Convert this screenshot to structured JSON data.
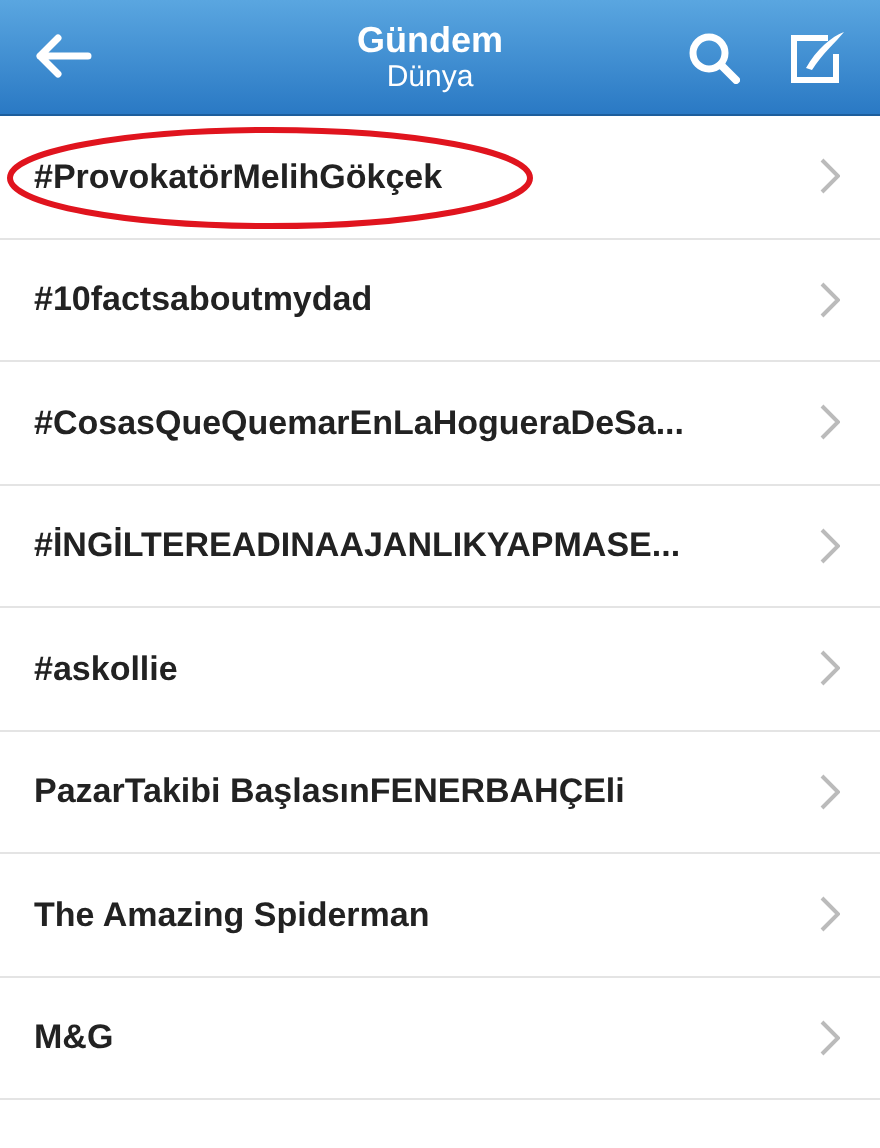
{
  "header": {
    "title": "Gündem",
    "subtitle": "Dünya"
  },
  "trends": [
    {
      "label": "#ProvokatörMelihGökçek",
      "circled": true
    },
    {
      "label": "#10factsaboutmydad",
      "circled": false
    },
    {
      "label": "#CosasQueQuemarEnLaHogueraDeSa...",
      "circled": false
    },
    {
      "label": "#İNGİLTEREADINAAJANLIKYAPMASE...",
      "circled": false
    },
    {
      "label": "#askollie",
      "circled": false
    },
    {
      "label": "PazarTakibi BaşlasınFENERBAHÇEli",
      "circled": false
    },
    {
      "label": "The Amazing Spiderman",
      "circled": false
    },
    {
      "label": "M&G",
      "circled": false
    }
  ]
}
